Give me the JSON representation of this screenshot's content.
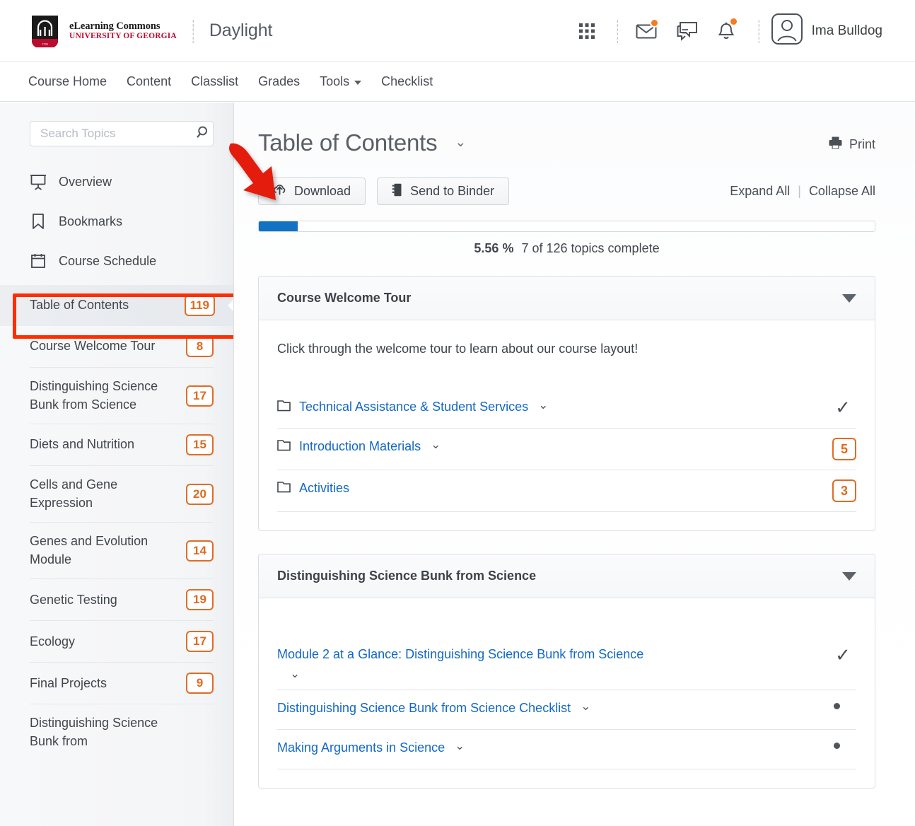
{
  "header": {
    "logo_line1": "eLearning Commons",
    "logo_line2": "UNIVERSITY OF GEORGIA",
    "app_title": "Daylight",
    "icons": [
      "waffle-grid-icon",
      "envelope-icon",
      "chat-bubble-icon",
      "bell-icon"
    ],
    "user_name": "Ima Bulldog",
    "accent_orange": "#f47b20",
    "brand_red": "#ba0c2f"
  },
  "nav": {
    "items": [
      {
        "label": "Course Home",
        "has_caret": false
      },
      {
        "label": "Content",
        "has_caret": false
      },
      {
        "label": "Classlist",
        "has_caret": false
      },
      {
        "label": "Grades",
        "has_caret": false
      },
      {
        "label": "Tools",
        "has_caret": true
      },
      {
        "label": "Checklist",
        "has_caret": false
      }
    ]
  },
  "sidebar": {
    "search_placeholder": "Search Topics",
    "search_value": "",
    "nav_items": [
      {
        "label": "Overview",
        "icon": "presentation-screen-icon"
      },
      {
        "label": "Bookmarks",
        "icon": "bookmark-icon"
      },
      {
        "label": "Course Schedule",
        "icon": "calendar-icon"
      }
    ],
    "toc_current": {
      "label": "Table of Contents",
      "count": "119"
    },
    "toc_items": [
      {
        "label": "Course Welcome Tour",
        "count": "8"
      },
      {
        "label": "Distinguishing Science Bunk from Science",
        "count": "17"
      },
      {
        "label": "Diets and Nutrition",
        "count": "15"
      },
      {
        "label": "Cells and Gene Expression",
        "count": "20"
      },
      {
        "label": "Genes and Evolution Module",
        "count": "14"
      },
      {
        "label": "Genetic Testing",
        "count": "19"
      },
      {
        "label": "Ecology",
        "count": "17"
      },
      {
        "label": "Final Projects",
        "count": "9"
      },
      {
        "label": "Distinguishing Science Bunk from",
        "count": ""
      }
    ]
  },
  "main": {
    "page_title": "Table of Contents",
    "title_caret": "⌄",
    "print_label": "Print",
    "buttons": {
      "download": "Download",
      "send_to_binder": "Send to Binder"
    },
    "expand_all": "Expand All",
    "collapse_all": "Collapse All",
    "separator": "|",
    "progress": {
      "percent_label": "5.56 %",
      "percent_value": 5.56,
      "status_text": "7 of 126 topics complete",
      "fill_color": "#1272c4"
    },
    "cards": [
      {
        "title": "Course Welcome Tour",
        "description": "Click through the welcome tour to learn about our course layout!",
        "items": [
          {
            "label": "Technical Assistance & Student Services",
            "icon": "folder-icon",
            "caret": "⌄",
            "status": "check",
            "badge": ""
          },
          {
            "label": "Introduction Materials",
            "icon": "folder-icon",
            "caret": "⌄",
            "status": "badge",
            "badge": "5"
          },
          {
            "label": "Activities",
            "icon": "folder-icon",
            "caret": "",
            "status": "badge",
            "badge": "3"
          }
        ]
      },
      {
        "title": "Distinguishing Science Bunk from Science",
        "description": "",
        "items": [
          {
            "label": "Module 2 at a Glance: Distinguishing Science Bunk from Science",
            "icon": "",
            "caret": "⌄",
            "caret_below": true,
            "status": "check",
            "badge": ""
          },
          {
            "label": "Distinguishing Science Bunk from Science Checklist",
            "icon": "",
            "caret": "⌄",
            "status": "dot",
            "badge": ""
          },
          {
            "label": "Making Arguments in Science",
            "icon": "",
            "caret": "⌄",
            "status": "dot",
            "badge": ""
          }
        ]
      }
    ]
  },
  "annotations": {
    "highlight_color": "#ff2d00",
    "arrow_color": "#e31c0b",
    "highlight_target": "Table of Contents",
    "arrow_target": "Download"
  }
}
